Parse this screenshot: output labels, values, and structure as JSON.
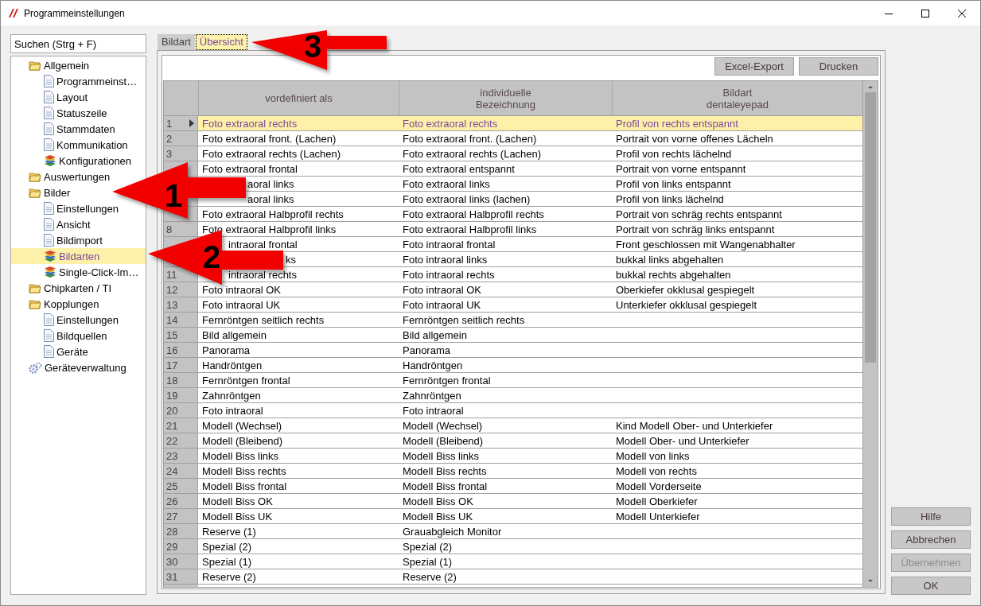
{
  "window": {
    "title": "Programmeinstellungen"
  },
  "search": {
    "placeholder": "Suchen (Strg + F)"
  },
  "tree": [
    {
      "label": "Allgemein",
      "kind": "folder",
      "selected": false,
      "children": [
        {
          "label": "Programmeinst…",
          "kind": "page",
          "selected": false
        },
        {
          "label": "Layout",
          "kind": "page",
          "selected": false
        },
        {
          "label": "Statuszeile",
          "kind": "page",
          "selected": false
        },
        {
          "label": "Stammdaten",
          "kind": "page",
          "selected": false
        },
        {
          "label": "Kommunikation",
          "kind": "page",
          "selected": false
        },
        {
          "label": "Konfigurationen",
          "kind": "stack",
          "selected": false
        }
      ]
    },
    {
      "label": "Auswertungen",
      "kind": "folder",
      "selected": false
    },
    {
      "label": "Bilder",
      "kind": "folder",
      "selected": false,
      "children": [
        {
          "label": "Einstellungen",
          "kind": "page",
          "selected": false
        },
        {
          "label": "Ansicht",
          "kind": "page",
          "selected": false
        },
        {
          "label": "Bildimport",
          "kind": "page",
          "selected": false
        },
        {
          "label": "Bildarten",
          "kind": "stack",
          "selected": true
        },
        {
          "label": "Single-Click-Im…",
          "kind": "stack",
          "selected": false
        }
      ]
    },
    {
      "label": "Chipkarten / TI",
      "kind": "folder",
      "selected": false
    },
    {
      "label": "Kopplungen",
      "kind": "folder",
      "selected": false,
      "children": [
        {
          "label": "Einstellungen",
          "kind": "page",
          "selected": false
        },
        {
          "label": "Bildquellen",
          "kind": "page",
          "selected": false
        },
        {
          "label": "Geräte",
          "kind": "page",
          "selected": false
        }
      ]
    },
    {
      "label": "Geräteverwaltung",
      "kind": "gears",
      "selected": false
    }
  ],
  "tabs": [
    {
      "label": "Bildart",
      "selected": false
    },
    {
      "label": "Übersicht",
      "selected": true
    }
  ],
  "toolbar_buttons": [
    "Excel-Export",
    "Drucken"
  ],
  "table": {
    "columns": [
      "vordefiniert als",
      "individuelle\nBezeichnung",
      "Bildart\ndentaleyepad"
    ],
    "rows": [
      {
        "number": "1",
        "selected": true,
        "cells": [
          "Foto extraoral rechts",
          "Foto extraoral rechts",
          "Profil von rechts entspannt"
        ]
      },
      {
        "number": "2",
        "selected": false,
        "cells": [
          "Foto extraoral front. (Lachen)",
          "Foto extraoral front. (Lachen)",
          "Portrait von vorne offenes Lächeln"
        ]
      },
      {
        "number": "3",
        "selected": false,
        "cells": [
          "Foto extraoral rechts (Lachen)",
          "Foto extraoral rechts (Lachen)",
          "Profil von rechts lächelnd"
        ]
      },
      {
        "selected": false,
        "cells": [
          "Foto extraoral frontal",
          "Foto extraoral entspannt",
          "Portrait von vorne entspannt"
        ]
      },
      {
        "selected": false,
        "cells": [
          "aoral links",
          "Foto extraoral links",
          "Profil von links entspannt"
        ]
      },
      {
        "selected": false,
        "cells": [
          "aoral links",
          "Foto extraoral links (lachen)",
          "Profil von links lächelnd"
        ]
      },
      {
        "selected": false,
        "cells": [
          "Foto extraoral Halbprofil rechts",
          "Foto extraoral Halbprofil rechts",
          "Portrait von schräg rechts entspannt"
        ]
      },
      {
        "number": "8",
        "selected": false,
        "cells": [
          "Foto extraoral Halbprofil links",
          "Foto extraoral Halbprofil links",
          "Portrait von schräg links entspannt"
        ]
      },
      {
        "selected": false,
        "cells": [
          "intraoral frontal",
          "Foto intraoral frontal",
          "Front geschlossen mit Wangenabhalter"
        ]
      },
      {
        "selected": false,
        "cells": [
          "ks",
          "Foto intraoral links",
          "bukkal links abgehalten"
        ]
      },
      {
        "number": "11",
        "selected": false,
        "cells": [
          "intraoral rechts",
          "Foto intraoral rechts",
          "bukkal rechts abgehalten"
        ]
      },
      {
        "number": "12",
        "selected": false,
        "cells": [
          "Foto intraoral OK",
          "Foto intraoral OK",
          "Oberkiefer okklusal gespiegelt"
        ]
      },
      {
        "number": "13",
        "selected": false,
        "cells": [
          "Foto intraoral UK",
          "Foto intraoral UK",
          "Unterkiefer okklusal gespiegelt"
        ]
      },
      {
        "number": "14",
        "selected": false,
        "cells": [
          "Fernröntgen seitlich rechts",
          "Fernröntgen seitlich rechts",
          ""
        ]
      },
      {
        "number": "15",
        "selected": false,
        "cells": [
          "Bild allgemein",
          "Bild allgemein",
          ""
        ]
      },
      {
        "number": "16",
        "selected": false,
        "cells": [
          "Panorama",
          "Panorama",
          ""
        ]
      },
      {
        "number": "17",
        "selected": false,
        "cells": [
          "Handröntgen",
          "Handröntgen",
          ""
        ]
      },
      {
        "number": "18",
        "selected": false,
        "cells": [
          "Fernröntgen frontal",
          "Fernröntgen frontal",
          ""
        ]
      },
      {
        "number": "19",
        "selected": false,
        "cells": [
          "Zahnröntgen",
          "Zahnröntgen",
          ""
        ]
      },
      {
        "number": "20",
        "selected": false,
        "cells": [
          "Foto intraoral",
          "Foto intraoral",
          ""
        ]
      },
      {
        "number": "21",
        "selected": false,
        "cells": [
          "Modell (Wechsel)",
          "Modell (Wechsel)",
          "Kind Modell Ober- und Unterkiefer"
        ]
      },
      {
        "number": "22",
        "selected": false,
        "cells": [
          "Modell (Bleibend)",
          "Modell (Bleibend)",
          "Modell Ober- und Unterkiefer"
        ]
      },
      {
        "number": "23",
        "selected": false,
        "cells": [
          "Modell Biss links",
          "Modell Biss links",
          "Modell von links"
        ]
      },
      {
        "number": "24",
        "selected": false,
        "cells": [
          "Modell Biss rechts",
          "Modell Biss rechts",
          "Modell von rechts"
        ]
      },
      {
        "number": "25",
        "selected": false,
        "cells": [
          "Modell Biss frontal",
          "Modell Biss frontal",
          "Modell Vorderseite"
        ]
      },
      {
        "number": "26",
        "selected": false,
        "cells": [
          "Modell Biss OK",
          "Modell Biss OK",
          "Modell Oberkiefer"
        ]
      },
      {
        "number": "27",
        "selected": false,
        "cells": [
          "Modell Biss UK",
          "Modell Biss UK",
          "Modell Unterkiefer"
        ]
      },
      {
        "number": "28",
        "selected": false,
        "cells": [
          "Reserve (1)",
          "Grauabgleich Monitor",
          ""
        ]
      },
      {
        "number": "29",
        "selected": false,
        "cells": [
          "Spezial (2)",
          "Spezial (2)",
          ""
        ]
      },
      {
        "number": "30",
        "selected": false,
        "cells": [
          "Spezial (1)",
          "Spezial (1)",
          ""
        ]
      },
      {
        "number": "31",
        "selected": false,
        "cells": [
          "Reserve (2)",
          "Reserve (2)",
          ""
        ]
      }
    ]
  },
  "dialog_buttons": [
    {
      "label": "Hilfe",
      "disabled": false
    },
    {
      "label": "Abbrechen",
      "disabled": false
    },
    {
      "label": "Übernehmen",
      "disabled": true
    },
    {
      "label": "OK",
      "disabled": false
    }
  ],
  "annotations": [
    {
      "label": "1"
    },
    {
      "label": "2"
    },
    {
      "label": "3"
    }
  ]
}
